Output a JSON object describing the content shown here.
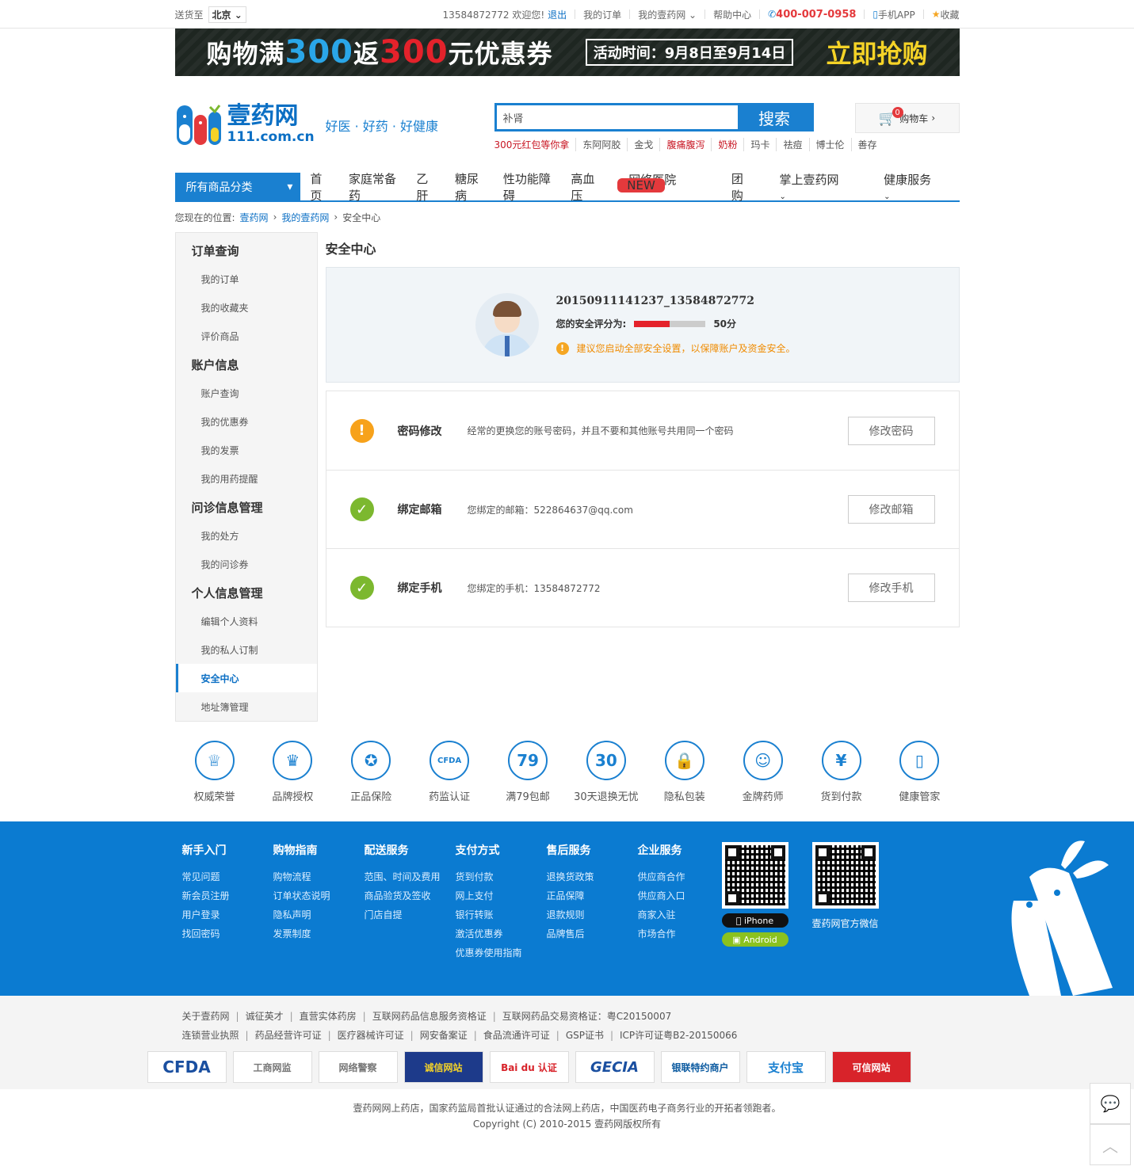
{
  "topbar": {
    "ship_to": "送货至",
    "city": "北京",
    "welcome": "13584872772 欢迎您!",
    "logout": "退出",
    "my_orders": "我的订单",
    "my_site": "我的壹药网",
    "help": "帮助中心",
    "phone": "400-007-0958",
    "app": "手机APP",
    "fav": "收藏"
  },
  "banner": {
    "t1": "购物满",
    "n1": "300",
    "t2": "返",
    "n2": "300",
    "t3": "元优惠券",
    "time": "活动时间：9月8日至9月14日",
    "cta": "立即抢购"
  },
  "header": {
    "logo_cn": "壹药网",
    "logo_en": "111.com.cn",
    "slogan": "好医 · 好药 · 好健康",
    "search_value": "补肾",
    "search_btn": "搜索",
    "hotwords": [
      "300元红包等你拿",
      "东阿阿胶",
      "金戈",
      "腹痛腹泻",
      "奶粉",
      "玛卡",
      "祛痘",
      "博士伦",
      "善存"
    ],
    "cart_count": "0",
    "cart_label": "购物车"
  },
  "nav": {
    "all": "所有商品分类",
    "links": [
      "首页",
      "家庭常备药",
      "乙肝",
      "糖尿病",
      "性功能障碍",
      "高血压",
      "网络医院",
      "团购",
      "掌上壹药网",
      "健康服务"
    ],
    "new_tag": "NEW"
  },
  "crumb": {
    "label": "您现在的位置:",
    "l1": "壹药网",
    "l2": "我的壹药网",
    "current": "安全中心"
  },
  "sidebar": {
    "g1": "订单查询",
    "g1_items": [
      "我的订单",
      "我的收藏夹",
      "评价商品"
    ],
    "g2": "账户信息",
    "g2_items": [
      "账户查询",
      "我的优惠券",
      "我的发票",
      "我的用药提醒"
    ],
    "g3": "问诊信息管理",
    "g3_items": [
      "我的处方",
      "我的问诊券"
    ],
    "g4": "个人信息管理",
    "g4_items": [
      "编辑个人资料",
      "我的私人订制",
      "安全中心",
      "地址簿管理"
    ]
  },
  "security": {
    "title": "安全中心",
    "username": "20150911141237_13584872772",
    "score_label": "您的安全评分为:",
    "score": "50分",
    "score_value": 0.5,
    "tip": "建议您启动全部安全设置，以保障账户及资金安全。",
    "rows": [
      {
        "name": "密码修改",
        "desc": "经常的更换您的账号密码，并且不要和其他账号共用同一个密码",
        "btn": "修改密码",
        "icon": "!"
      },
      {
        "name": "绑定邮箱",
        "desc": "您绑定的邮箱：522864637@qq.com",
        "btn": "修改邮箱",
        "icon": "✓"
      },
      {
        "name": "绑定手机",
        "desc": "您绑定的手机：13584872772",
        "btn": "修改手机",
        "icon": "✓"
      }
    ]
  },
  "features": [
    {
      "icon": "♕",
      "label": "权威荣誉"
    },
    {
      "icon": "♛",
      "label": "品牌授权"
    },
    {
      "icon": "✪",
      "label": "正品保险"
    },
    {
      "icon": "CFDA",
      "label": "药监认证"
    },
    {
      "icon": "79",
      "label": "满79包邮"
    },
    {
      "icon": "30",
      "label": "30天退换无忧"
    },
    {
      "icon": "🔒",
      "label": "隐私包装"
    },
    {
      "icon": "☺",
      "label": "金牌药师"
    },
    {
      "icon": "¥",
      "label": "货到付款"
    },
    {
      "icon": "▯",
      "label": "健康管家"
    }
  ],
  "footer": {
    "cols": [
      {
        "title": "新手入门",
        "items": [
          "常见问题",
          "新会员注册",
          "用户登录",
          "找回密码"
        ]
      },
      {
        "title": "购物指南",
        "items": [
          "购物流程",
          "订单状态说明",
          "隐私声明",
          "发票制度"
        ]
      },
      {
        "title": "配送服务",
        "items": [
          "范围、时间及费用",
          "商品验货及签收",
          "门店自提"
        ]
      },
      {
        "title": "支付方式",
        "items": [
          "货到付款",
          "网上支付",
          "银行转账",
          "激活优惠券",
          "优惠券使用指南"
        ]
      },
      {
        "title": "售后服务",
        "items": [
          "退换货政策",
          "正品保障",
          "退款规则",
          "品牌售后"
        ]
      },
      {
        "title": "企业服务",
        "items": [
          "供应商合作",
          "供应商入口",
          "商家入驻",
          "市场合作"
        ]
      }
    ],
    "iphone": "iPhone",
    "android": "Android",
    "wechat": "壹药网官方微信"
  },
  "links": {
    "row1": [
      "关于壹药网",
      "诚征英才",
      "直营实体药房",
      "互联网药品信息服务资格证",
      "互联网药品交易资格证：粤C20150007"
    ],
    "row2": [
      "连锁营业执照",
      "药品经营许可证",
      "医疗器械许可证",
      "网安备案证",
      "食品流通许可证",
      "GSP证书",
      "ICP许可证粤B2-20150066"
    ],
    "badges": [
      "CFDA",
      "工商网监",
      "网络警察",
      "诚信网站",
      "Bai du 认证",
      "GECIA",
      "银联特约商户",
      "支付宝",
      "可信网站"
    ]
  },
  "copy": {
    "l1": "壹药网网上药店，国家药监局首批认证通过的合法网上药店，中国医药电子商务行业的开拓者领跑者。",
    "l2": "Copyright (C) 2010-2015 壹药网版权所有"
  },
  "colors": {
    "brand": "#1a80d0",
    "alert": "#e4393c",
    "warn": "#f7a21b",
    "ok": "#7cb82f"
  }
}
